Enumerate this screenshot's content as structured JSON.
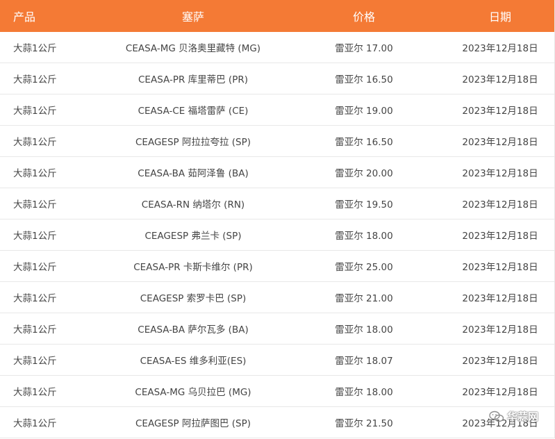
{
  "table": {
    "headers": {
      "product": "产品",
      "ceasa": "塞萨",
      "price": "价格",
      "date": "日期"
    },
    "rows": [
      {
        "product": "大蒜1公斤",
        "ceasa": "CEASA-MG 贝洛奥里藏特 (MG)",
        "price": "雷亚尔 17.00",
        "date": "2023年12月18日"
      },
      {
        "product": "大蒜1公斤",
        "ceasa": "CEASA-PR 库里蒂巴 (PR)",
        "price": "雷亚尔 16.50",
        "date": "2023年12月18日"
      },
      {
        "product": "大蒜1公斤",
        "ceasa": "CEASA-CE 福塔雷萨 (CE)",
        "price": "雷亚尔 19.00",
        "date": "2023年12月18日"
      },
      {
        "product": "大蒜1公斤",
        "ceasa": "CEAGESP 阿拉拉夸拉 (SP)",
        "price": "雷亚尔 16.50",
        "date": "2023年12月18日"
      },
      {
        "product": "大蒜1公斤",
        "ceasa": "CEASA-BA 茹阿泽鲁 (BA)",
        "price": "雷亚尔 20.00",
        "date": "2023年12月18日"
      },
      {
        "product": "大蒜1公斤",
        "ceasa": "CEASA-RN 纳塔尔 (RN)",
        "price": "雷亚尔 19.50",
        "date": "2023年12月18日"
      },
      {
        "product": "大蒜1公斤",
        "ceasa": "CEAGESP 弗兰卡 (SP)",
        "price": "雷亚尔 18.00",
        "date": "2023年12月18日"
      },
      {
        "product": "大蒜1公斤",
        "ceasa": "CEASA-PR 卡斯卡维尔 (PR)",
        "price": "雷亚尔 25.00",
        "date": "2023年12月18日"
      },
      {
        "product": "大蒜1公斤",
        "ceasa": "CEAGESP 索罗卡巴 (SP)",
        "price": "雷亚尔 21.00",
        "date": "2023年12月18日"
      },
      {
        "product": "大蒜1公斤",
        "ceasa": "CEASA-BA 萨尔瓦多 (BA)",
        "price": "雷亚尔 18.00",
        "date": "2023年12月18日"
      },
      {
        "product": "大蒜1公斤",
        "ceasa": "CEASA-ES 维多利亚(ES)",
        "price": "雷亚尔 18.07",
        "date": "2023年12月18日"
      },
      {
        "product": "大蒜1公斤",
        "ceasa": "CEASA-MG 乌贝拉巴 (MG)",
        "price": "雷亚尔 18.00",
        "date": "2023年12月18日"
      },
      {
        "product": "大蒜1公斤",
        "ceasa": "CEAGESP 阿拉萨图巴 (SP)",
        "price": "雷亚尔 21.50",
        "date": "2023年12月18日"
      }
    ]
  },
  "watermark": {
    "text": "华蒜网",
    "icon": "wechat-icon"
  },
  "colors": {
    "header_bg": "#f47a35",
    "header_text": "#ffffff",
    "row_border": "#e8e8e8",
    "cell_text": "#444444"
  }
}
